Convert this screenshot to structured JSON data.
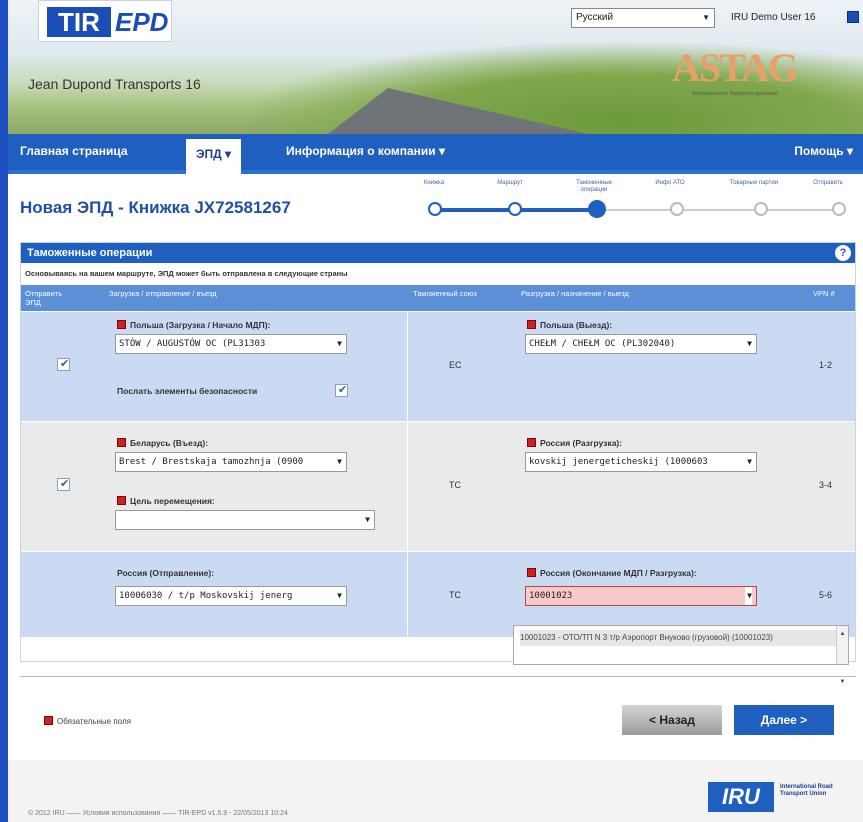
{
  "header": {
    "logo_tir": "TIR",
    "logo_epd": "EPD",
    "company": "Jean Dupond Transports 16",
    "language": "Русский",
    "user": "IRU Demo User 16",
    "partner_logo": "ASTAG",
    "partner_sub": "Schweizerischer Nutzfahrzeugverband"
  },
  "nav": {
    "home": "Главная страница",
    "epd": "ЭПД ▾",
    "company_info": "Информация о компании ▾",
    "help": "Помощь ▾"
  },
  "page": {
    "title": "Новая ЭПД - Книжка JX72581267"
  },
  "steps": [
    "Книжка",
    "Маршрут",
    "Таможенные операции",
    "Инфо АТО",
    "Товарные партии",
    "Отправить"
  ],
  "panel": {
    "title": "Таможенные операции",
    "intro": "Основываясь на вашем маршруте, ЭПД может быть отправлена в следующие страны",
    "columns": {
      "send": "Отправить ЭПД",
      "loading": "Загрузка / отправление / въезд",
      "zone": "Таможенный союз",
      "unloading": "Разгрузка / назначение / выезд",
      "vpn": "VPN #"
    },
    "rows": [
      {
        "checked": true,
        "left_label": "Польша (Загрузка / Начало МДП):",
        "left_value": "STÓW / AUGUSTÓW OC (PL31303",
        "extra_label": "Послать элементы безопасности",
        "zone": "EC",
        "right_label": "Польша (Выезд):",
        "right_value": "CHEŁM / CHEŁM OC (PL302040)",
        "vpn": "1-2"
      },
      {
        "checked": true,
        "left_label": "Беларусь (Въезд):",
        "left_value": "Brest / Brestskaja tamozhnja (0900",
        "extra_label": "Цель перемещения:",
        "zone": "TC",
        "right_label": "Россия (Разгрузка):",
        "right_value": "kovskij jenergeticheskij (1000603",
        "vpn": "3-4"
      },
      {
        "checked": false,
        "left_label": "Россия (Отправление):",
        "left_value": "10006030 / t/p Moskovskij jenerg",
        "zone": "TC",
        "right_label": "Россия (Окончание МДП / Разгрузка):",
        "right_value": "10001023",
        "vpn": "5-6"
      }
    ],
    "dropdown_option": "10001023 - ОТО/ТП N 3 т/р Аэропорт Внуково (грузовой) (10001023)"
  },
  "footer": {
    "required": "Обязательные поля",
    "back": "< Назад",
    "next": "Далее >",
    "copyright": "© 2012 IRU —— Условия использования —— TIR-EPD v1.5.9 - 22/05/2013 10:24",
    "iru": "IRU",
    "iru_full": "International Road Transport Union"
  }
}
